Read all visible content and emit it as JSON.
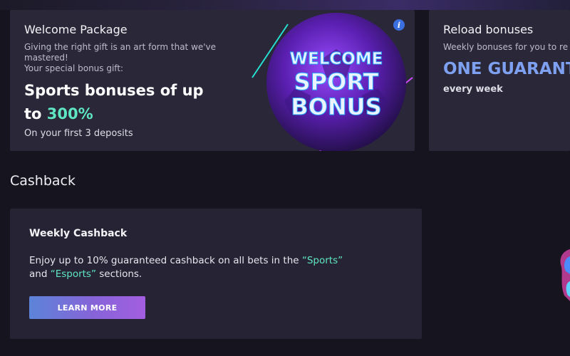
{
  "welcome_card": {
    "title": "Welcome Package",
    "subtitle_line1": "Giving the right gift is an art form that we've",
    "subtitle_line2": "mastered!",
    "subtitle_line3": "Your special bonus gift:",
    "headline_line1": "Sports bonuses of up",
    "headline_prefix": "to ",
    "headline_accent": "300%",
    "footnote": "On your first 3 deposits",
    "banner_line1": "WELCOME",
    "banner_line2": "SPORT",
    "banner_line3": "BONUS",
    "info_icon": "i"
  },
  "reload_card": {
    "title": "Reload bonuses",
    "subtitle": "Weekly bonuses for you to re",
    "headline": "ONE GUARANT",
    "footnote": "every week"
  },
  "cashback_section": {
    "heading": "Cashback",
    "card_title": "Weekly Cashback",
    "text_part1": "Enjoy up to 10% guaranteed cashback on all bets in the ",
    "text_quote1": "“Sports”",
    "text_part2": " and ",
    "text_quote2": "“Esports”",
    "text_part3": " sections.",
    "button_label": "LEARN MORE"
  },
  "colors": {
    "background": "#16141f",
    "card": "#2a2838",
    "accent_teal": "#5fe6c2",
    "accent_blue": "#7ea0f0",
    "button_gradient_start": "#5c84d8",
    "button_gradient_end": "#a35ee0"
  }
}
